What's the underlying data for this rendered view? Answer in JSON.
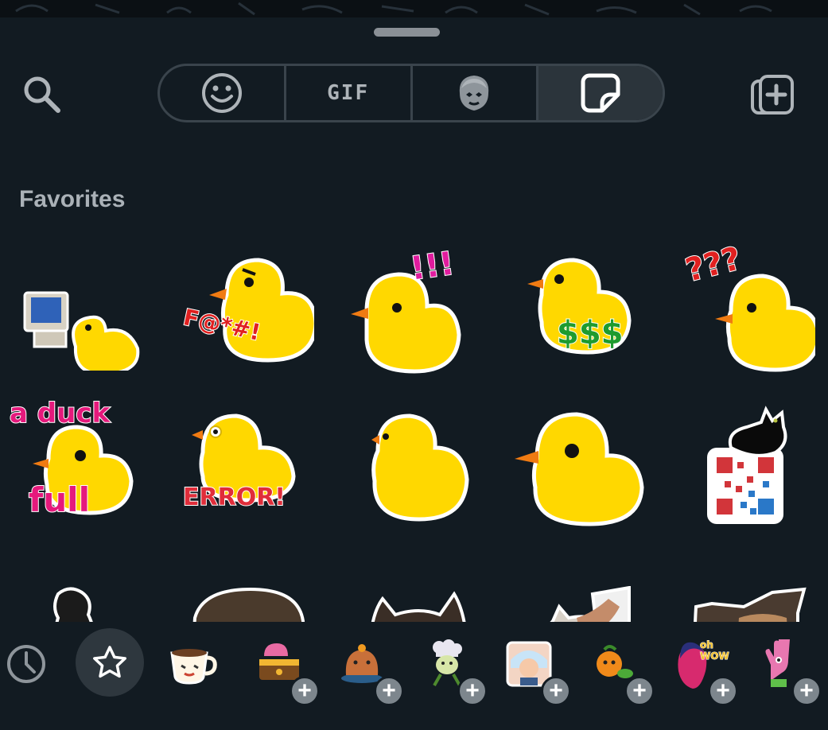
{
  "tabs": [
    {
      "name": "emoji",
      "icon": "emoji-icon"
    },
    {
      "name": "gif",
      "label": "GIF"
    },
    {
      "name": "avatar",
      "icon": "avatar-icon"
    },
    {
      "name": "stickers",
      "icon": "sticker-icon",
      "active": true
    }
  ],
  "section_title": "Favorites",
  "stickers": {
    "row1": [
      {
        "name": "duck-computer"
      },
      {
        "name": "duck-swear",
        "caption": "F@*#!"
      },
      {
        "name": "duck-exclaim",
        "caption": "!!!"
      },
      {
        "name": "duck-money",
        "caption": "$$$"
      },
      {
        "name": "duck-question",
        "caption": "???"
      }
    ],
    "row2": [
      {
        "name": "duck-a-duck-full",
        "caption_top": "a duck",
        "caption_bottom": "full"
      },
      {
        "name": "duck-error",
        "caption": "ERROR!"
      },
      {
        "name": "duck-plain"
      },
      {
        "name": "duck-large"
      },
      {
        "name": "cat-qr-code"
      }
    ],
    "row3": [
      {
        "name": "black-dog"
      },
      {
        "name": "calico-cat-lying"
      },
      {
        "name": "calico-cat-face"
      },
      {
        "name": "cat-petted"
      },
      {
        "name": "calico-cat-frown"
      }
    ]
  },
  "bottom_packs": [
    {
      "name": "recent",
      "icon": "clock-icon"
    },
    {
      "name": "favorites",
      "icon": "star-icon",
      "selected": true
    },
    {
      "name": "coffee-cup-pack"
    },
    {
      "name": "treasure-chest-pack",
      "add": true
    },
    {
      "name": "capybara-pack",
      "add": true
    },
    {
      "name": "chef-pack",
      "add": true
    },
    {
      "name": "photo-pack",
      "add": true
    },
    {
      "name": "fruit-pack",
      "add": true
    },
    {
      "name": "oh-wow-pack",
      "caption": "oh WOW",
      "add": true
    },
    {
      "name": "hand-pack",
      "add": true
    }
  ],
  "plus_symbol": "+",
  "colors": {
    "background": "#121b22",
    "duck_yellow": "#ffd800",
    "duck_beak": "#f07b12",
    "tab_border": "#3a444c"
  }
}
